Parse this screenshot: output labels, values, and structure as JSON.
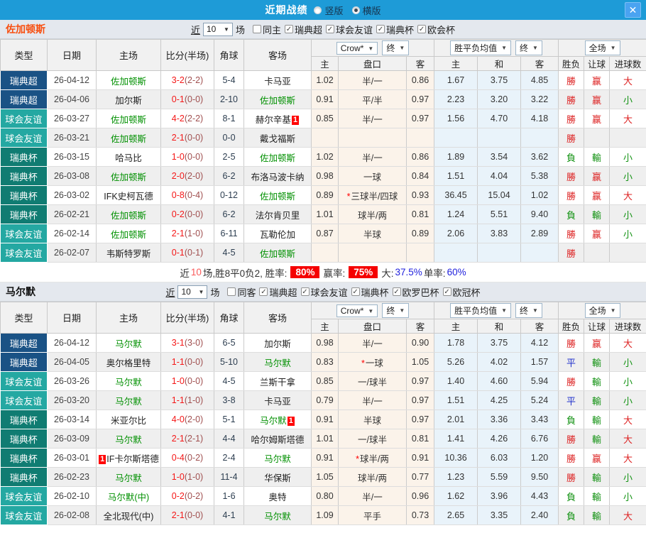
{
  "titlebar": {
    "title": "近期战绩",
    "radios": [
      {
        "label": "竖版",
        "selected": false
      },
      {
        "label": "横版",
        "selected": true
      }
    ],
    "close_glyph": "✕"
  },
  "table_headers": {
    "cols": [
      "类型",
      "日期",
      "主场",
      "比分(半场)",
      "角球",
      "客场"
    ],
    "sub": [
      "主",
      "盘口",
      "客",
      "主",
      "和",
      "客",
      "胜负",
      "让球",
      "进球数"
    ],
    "dropdowns": {
      "bookmaker": "Crow*",
      "final1": "终",
      "avg": "胜平负均值",
      "final2": "终",
      "scope": "全场"
    }
  },
  "type_colors": {
    "瑞典超": "#1a5285",
    "球会友谊": "#24a8a2",
    "瑞典杯": "#107c72"
  },
  "value_colors": {
    "勝": "red",
    "平": "blue",
    "負": "green",
    "赢": "red",
    "輸": "green",
    "大": "red",
    "小": "green"
  },
  "sections": [
    {
      "team": "佐加顿斯",
      "team_color": "#f84e0e",
      "near_label": "近",
      "count": "10",
      "games_label": "场",
      "filters": [
        {
          "label": "同主",
          "checked": false
        },
        {
          "label": "瑞典超",
          "checked": true
        },
        {
          "label": "球会友谊",
          "checked": true
        },
        {
          "label": "瑞典杯",
          "checked": true
        },
        {
          "label": "欧会杯",
          "checked": true
        }
      ],
      "rows": [
        {
          "type": "瑞典超",
          "date": "26-04-12",
          "home": "佐加顿斯",
          "home_green": true,
          "home_badge_pre": "",
          "home_badge_post": "",
          "ft": "3-2",
          "ht": "(2-2)",
          "corner": "5-4",
          "away": "卡马亚",
          "away_green": false,
          "away_badge_post": "",
          "o1": "1.02",
          "hc_star": "",
          "hc": "半/一",
          "o2": "0.86",
          "a1": "1.67",
          "a2": "3.75",
          "a3": "4.85",
          "r": "勝",
          "hr": "赢",
          "g": "大"
        },
        {
          "type": "瑞典超",
          "date": "26-04-06",
          "home": "加尔斯",
          "home_green": false,
          "home_badge_pre": "",
          "home_badge_post": "",
          "ft": "0-1",
          "ht": "(0-0)",
          "corner": "2-10",
          "away": "佐加顿斯",
          "away_green": true,
          "away_badge_post": "",
          "o1": "0.91",
          "hc_star": "",
          "hc": "平/半",
          "o2": "0.97",
          "a1": "2.23",
          "a2": "3.20",
          "a3": "3.22",
          "r": "勝",
          "hr": "赢",
          "g": "小"
        },
        {
          "type": "球会友谊",
          "date": "26-03-27",
          "home": "佐加顿斯",
          "home_green": true,
          "home_badge_pre": "",
          "home_badge_post": "",
          "ft": "4-2",
          "ht": "(2-2)",
          "corner": "8-1",
          "away": "赫尔辛基",
          "away_green": false,
          "away_badge_post": "1",
          "o1": "0.85",
          "hc_star": "",
          "hc": "半/一",
          "o2": "0.97",
          "a1": "1.56",
          "a2": "4.70",
          "a3": "4.18",
          "r": "勝",
          "hr": "赢",
          "g": "大"
        },
        {
          "type": "球会友谊",
          "date": "26-03-21",
          "home": "佐加顿斯",
          "home_green": true,
          "home_badge_pre": "",
          "home_badge_post": "",
          "ft": "2-1",
          "ht": "(0-0)",
          "corner": "0-0",
          "away": "戴戈福斯",
          "away_green": false,
          "away_badge_post": "",
          "o1": "",
          "hc_star": "",
          "hc": "",
          "o2": "",
          "a1": "",
          "a2": "",
          "a3": "",
          "r": "勝",
          "hr": "",
          "g": ""
        },
        {
          "type": "瑞典杯",
          "date": "26-03-15",
          "home": "哈马比",
          "home_green": false,
          "home_badge_pre": "",
          "home_badge_post": "",
          "ft": "1-0",
          "ht": "(0-0)",
          "corner": "2-5",
          "away": "佐加顿斯",
          "away_green": true,
          "away_badge_post": "",
          "o1": "1.02",
          "hc_star": "",
          "hc": "半/一",
          "o2": "0.86",
          "a1": "1.89",
          "a2": "3.54",
          "a3": "3.62",
          "r": "負",
          "hr": "輸",
          "g": "小"
        },
        {
          "type": "瑞典杯",
          "date": "26-03-08",
          "home": "佐加顿斯",
          "home_green": true,
          "home_badge_pre": "",
          "home_badge_post": "",
          "ft": "2-0",
          "ht": "(2-0)",
          "corner": "6-2",
          "away": "布洛马波卡纳",
          "away_green": false,
          "away_badge_post": "",
          "o1": "0.98",
          "hc_star": "",
          "hc": "一球",
          "o2": "0.84",
          "a1": "1.51",
          "a2": "4.04",
          "a3": "5.38",
          "r": "勝",
          "hr": "赢",
          "g": "小"
        },
        {
          "type": "瑞典杯",
          "date": "26-03-02",
          "home": "IFK史柯瓦德",
          "home_green": false,
          "home_badge_pre": "",
          "home_badge_post": "",
          "ft": "0-8",
          "ht": "(0-4)",
          "corner": "0-12",
          "away": "佐加顿斯",
          "away_green": true,
          "away_badge_post": "",
          "o1": "0.89",
          "hc_star": "*",
          "hc": "三球半/四球",
          "o2": "0.93",
          "a1": "36.45",
          "a2": "15.04",
          "a3": "1.02",
          "r": "勝",
          "hr": "赢",
          "g": "大"
        },
        {
          "type": "瑞典杯",
          "date": "26-02-21",
          "home": "佐加顿斯",
          "home_green": true,
          "home_badge_pre": "",
          "home_badge_post": "",
          "ft": "0-2",
          "ht": "(0-0)",
          "corner": "6-2",
          "away": "法尔肯贝里",
          "away_green": false,
          "away_badge_post": "",
          "o1": "1.01",
          "hc_star": "",
          "hc": "球半/两",
          "o2": "0.81",
          "a1": "1.24",
          "a2": "5.51",
          "a3": "9.40",
          "r": "負",
          "hr": "輸",
          "g": "小"
        },
        {
          "type": "球会友谊",
          "date": "26-02-14",
          "home": "佐加顿斯",
          "home_green": true,
          "home_badge_pre": "",
          "home_badge_post": "",
          "ft": "2-1",
          "ht": "(1-0)",
          "corner": "6-11",
          "away": "瓦勒伦加",
          "away_green": false,
          "away_badge_post": "",
          "o1": "0.87",
          "hc_star": "",
          "hc": "半球",
          "o2": "0.89",
          "a1": "2.06",
          "a2": "3.83",
          "a3": "2.89",
          "r": "勝",
          "hr": "赢",
          "g": "小"
        },
        {
          "type": "球会友谊",
          "date": "26-02-07",
          "home": "韦斯特罗斯",
          "home_green": false,
          "home_badge_pre": "",
          "home_badge_post": "",
          "ft": "0-1",
          "ht": "(0-1)",
          "corner": "4-5",
          "away": "佐加顿斯",
          "away_green": true,
          "away_badge_post": "",
          "o1": "",
          "hc_star": "",
          "hc": "",
          "o2": "",
          "a1": "",
          "a2": "",
          "a3": "",
          "r": "勝",
          "hr": "",
          "g": ""
        }
      ],
      "summary": [
        {
          "t": "近",
          "s": "plain"
        },
        {
          "t": "10",
          "s": "pink"
        },
        {
          "t": "场,胜8平0负2, 胜率:",
          "s": "plain"
        },
        {
          "t": "80%",
          "s": "redbox"
        },
        {
          "t": "赢率:",
          "s": "plain"
        },
        {
          "t": "75%",
          "s": "redbox"
        },
        {
          "t": "大:",
          "s": "plain"
        },
        {
          "t": "37.5%",
          "s": "blue"
        },
        {
          "t": "单率:",
          "s": "plain"
        },
        {
          "t": "60%",
          "s": "blue"
        }
      ]
    },
    {
      "team": "马尔默",
      "team_color": "#111111",
      "near_label": "近",
      "count": "10",
      "games_label": "场",
      "filters": [
        {
          "label": "同客",
          "checked": false
        },
        {
          "label": "瑞典超",
          "checked": true
        },
        {
          "label": "球会友谊",
          "checked": true
        },
        {
          "label": "瑞典杯",
          "checked": true
        },
        {
          "label": "欧罗巴杯",
          "checked": true
        },
        {
          "label": "欧冠杯",
          "checked": true
        }
      ],
      "rows": [
        {
          "type": "瑞典超",
          "date": "26-04-12",
          "home": "马尔默",
          "home_green": true,
          "home_badge_pre": "",
          "home_badge_post": "",
          "ft": "3-1",
          "ht": "(3-0)",
          "corner": "6-5",
          "away": "加尔斯",
          "away_green": false,
          "away_badge_post": "",
          "o1": "0.98",
          "hc_star": "",
          "hc": "半/一",
          "o2": "0.90",
          "a1": "1.78",
          "a2": "3.75",
          "a3": "4.12",
          "r": "勝",
          "hr": "赢",
          "g": "大"
        },
        {
          "type": "瑞典超",
          "date": "26-04-05",
          "home": "奥尔格里特",
          "home_green": false,
          "home_badge_pre": "",
          "home_badge_post": "",
          "ft": "1-1",
          "ht": "(0-0)",
          "corner": "5-10",
          "away": "马尔默",
          "away_green": true,
          "away_badge_post": "",
          "o1": "0.83",
          "hc_star": "*",
          "hc": "一球",
          "o2": "1.05",
          "a1": "5.26",
          "a2": "4.02",
          "a3": "1.57",
          "r": "平",
          "hr": "輸",
          "g": "小"
        },
        {
          "type": "球会友谊",
          "date": "26-03-26",
          "home": "马尔默",
          "home_green": true,
          "home_badge_pre": "",
          "home_badge_post": "",
          "ft": "1-0",
          "ht": "(0-0)",
          "corner": "4-5",
          "away": "兰斯干拿",
          "away_green": false,
          "away_badge_post": "",
          "o1": "0.85",
          "hc_star": "",
          "hc": "一/球半",
          "o2": "0.97",
          "a1": "1.40",
          "a2": "4.60",
          "a3": "5.94",
          "r": "勝",
          "hr": "輸",
          "g": "小"
        },
        {
          "type": "球会友谊",
          "date": "26-03-20",
          "home": "马尔默",
          "home_green": true,
          "home_badge_pre": "",
          "home_badge_post": "",
          "ft": "1-1",
          "ht": "(1-0)",
          "corner": "3-8",
          "away": "卡马亚",
          "away_green": false,
          "away_badge_post": "",
          "o1": "0.79",
          "hc_star": "",
          "hc": "半/一",
          "o2": "0.97",
          "a1": "1.51",
          "a2": "4.25",
          "a3": "5.24",
          "r": "平",
          "hr": "輸",
          "g": "小"
        },
        {
          "type": "瑞典杯",
          "date": "26-03-14",
          "home": "米亚尔比",
          "home_green": false,
          "home_badge_pre": "",
          "home_badge_post": "",
          "ft": "4-0",
          "ht": "(2-0)",
          "corner": "5-1",
          "away": "马尔默",
          "away_green": true,
          "away_badge_post": "1",
          "o1": "0.91",
          "hc_star": "",
          "hc": "半球",
          "o2": "0.97",
          "a1": "2.01",
          "a2": "3.36",
          "a3": "3.43",
          "r": "負",
          "hr": "輸",
          "g": "大"
        },
        {
          "type": "瑞典杯",
          "date": "26-03-09",
          "home": "马尔默",
          "home_green": true,
          "home_badge_pre": "",
          "home_badge_post": "",
          "ft": "2-1",
          "ht": "(2-1)",
          "corner": "4-4",
          "away": "哈尔姆斯塔德",
          "away_green": false,
          "away_badge_post": "",
          "o1": "1.01",
          "hc_star": "",
          "hc": "一/球半",
          "o2": "0.81",
          "a1": "1.41",
          "a2": "4.26",
          "a3": "6.76",
          "r": "勝",
          "hr": "輸",
          "g": "大"
        },
        {
          "type": "瑞典杯",
          "date": "26-03-01",
          "home": "IF卡尔斯塔德",
          "home_green": false,
          "home_badge_pre": "1",
          "home_badge_post": "",
          "ft": "0-4",
          "ht": "(0-2)",
          "corner": "2-4",
          "away": "马尔默",
          "away_green": true,
          "away_badge_post": "",
          "o1": "0.91",
          "hc_star": "*",
          "hc": "球半/两",
          "o2": "0.91",
          "a1": "10.36",
          "a2": "6.03",
          "a3": "1.20",
          "r": "勝",
          "hr": "赢",
          "g": "大"
        },
        {
          "type": "瑞典杯",
          "date": "26-02-23",
          "home": "马尔默",
          "home_green": true,
          "home_badge_pre": "",
          "home_badge_post": "",
          "ft": "1-0",
          "ht": "(1-0)",
          "corner": "11-4",
          "away": "华保斯",
          "away_green": false,
          "away_badge_post": "",
          "o1": "1.05",
          "hc_star": "",
          "hc": "球半/两",
          "o2": "0.77",
          "a1": "1.23",
          "a2": "5.59",
          "a3": "9.50",
          "r": "勝",
          "hr": "輸",
          "g": "小"
        },
        {
          "type": "球会友谊",
          "date": "26-02-10",
          "home": "马尔默(中)",
          "home_green": true,
          "home_badge_pre": "",
          "home_badge_post": "",
          "ft": "0-2",
          "ht": "(0-2)",
          "corner": "1-6",
          "away": "奥特",
          "away_green": false,
          "away_badge_post": "",
          "o1": "0.80",
          "hc_star": "",
          "hc": "半/一",
          "o2": "0.96",
          "a1": "1.62",
          "a2": "3.96",
          "a3": "4.43",
          "r": "負",
          "hr": "輸",
          "g": "小"
        },
        {
          "type": "球会友谊",
          "date": "26-02-08",
          "home": "全北现代(中)",
          "home_green": false,
          "home_badge_pre": "",
          "home_badge_post": "",
          "ft": "2-1",
          "ht": "(0-0)",
          "corner": "4-1",
          "away": "马尔默",
          "away_green": true,
          "away_badge_post": "",
          "o1": "1.09",
          "hc_star": "",
          "hc": "平手",
          "o2": "0.73",
          "a1": "2.65",
          "a2": "3.35",
          "a3": "2.40",
          "r": "負",
          "hr": "輸",
          "g": "大"
        }
      ],
      "summary": null
    }
  ]
}
